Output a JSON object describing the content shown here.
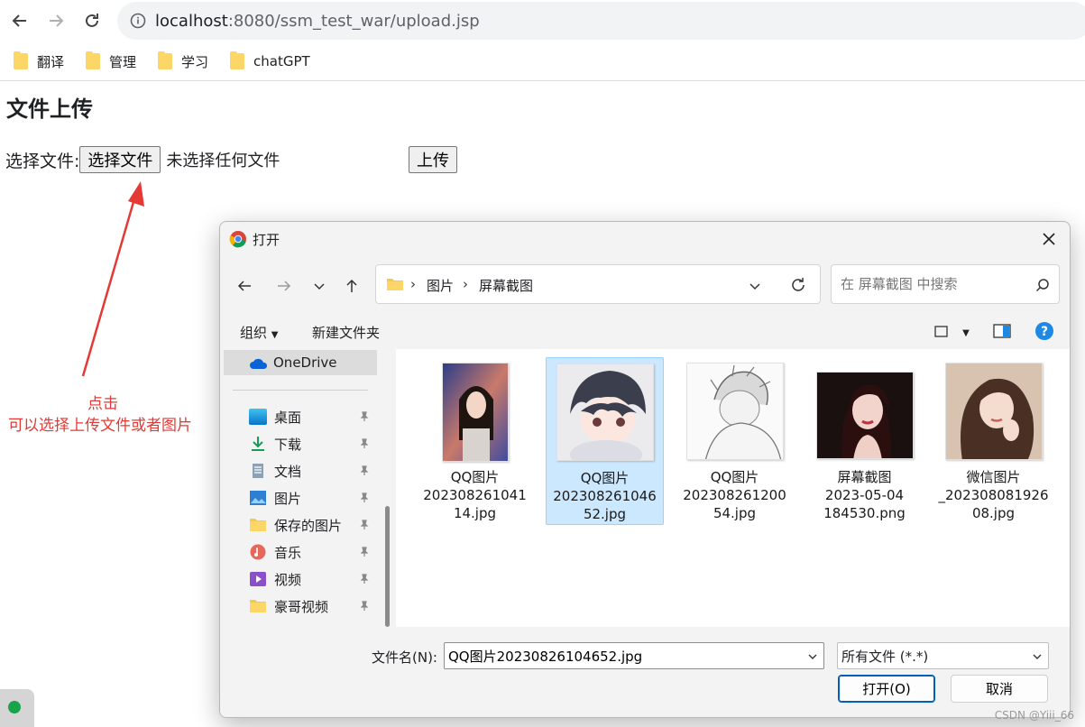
{
  "browser": {
    "url_host": "localhost",
    "url_rest": ":8080/ssm_test_war/upload.jsp",
    "bookmarks": [
      {
        "label": "翻译"
      },
      {
        "label": "管理"
      },
      {
        "label": "学习"
      },
      {
        "label": "chatGPT"
      }
    ]
  },
  "page": {
    "title": "文件上传",
    "file_label": "选择文件:",
    "choose_button": "选择文件",
    "no_file_text": "未选择任何文件",
    "upload_button": "上传"
  },
  "annotation": {
    "line1": "点击",
    "line2": "可以选择上传文件或者图片",
    "color": "#e53935"
  },
  "dialog": {
    "title": "打开",
    "breadcrumb": [
      "图片",
      "屏幕截图"
    ],
    "search_placeholder": "在 屏幕截图 中搜索",
    "toolbar": {
      "organize": "组织",
      "new_folder": "新建文件夹"
    },
    "sidebar": {
      "onedrive": "OneDrive",
      "items": [
        {
          "label": "桌面",
          "icon": "desktop-icon"
        },
        {
          "label": "下载",
          "icon": "download-icon"
        },
        {
          "label": "文档",
          "icon": "document-icon"
        },
        {
          "label": "图片",
          "icon": "picture-icon"
        },
        {
          "label": "保存的图片",
          "icon": "folder-icon"
        },
        {
          "label": "音乐",
          "icon": "music-icon"
        },
        {
          "label": "视频",
          "icon": "video-icon"
        },
        {
          "label": "豪哥视频",
          "icon": "folder-icon"
        }
      ]
    },
    "files": [
      {
        "lines": [
          "QQ图片",
          "202308261041",
          "14.jpg"
        ],
        "selected": false
      },
      {
        "lines": [
          "QQ图片",
          "202308261046",
          "52.jpg"
        ],
        "selected": true
      },
      {
        "lines": [
          "QQ图片",
          "202308261200",
          "54.jpg"
        ],
        "selected": false
      },
      {
        "lines": [
          "屏幕截图",
          "2023-05-04",
          "184530.png"
        ],
        "selected": false
      },
      {
        "lines": [
          "微信图片",
          "_202308081926",
          "08.jpg"
        ],
        "selected": false
      }
    ],
    "filename_label": "文件名(N):",
    "filename_value": "QQ图片20230826104652.jpg",
    "filetype_value": "所有文件 (*.*)",
    "open_button": "打开(O)",
    "cancel_button": "取消",
    "accent_color": "#005fb8",
    "selection_color": "#cce8ff"
  },
  "watermark": "CSDN @Yiii_66"
}
